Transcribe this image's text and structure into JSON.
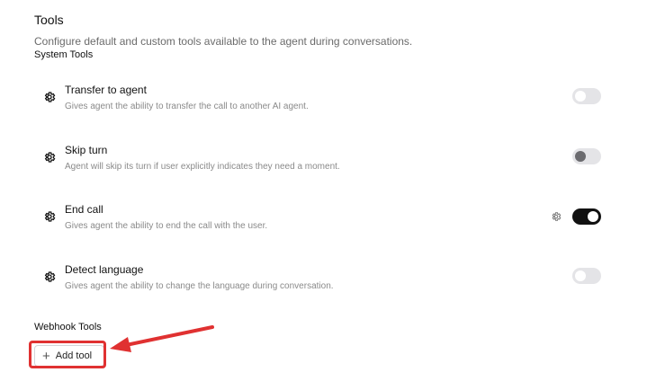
{
  "header": {
    "title": "Tools",
    "description": "Configure default and custom tools available to the agent during conversations."
  },
  "system_tools": {
    "title": "System Tools",
    "items": [
      {
        "name": "Transfer to agent",
        "description": "Gives agent the ability to transfer the call to another AI agent.",
        "enabled": false,
        "icon": "gear-icon"
      },
      {
        "name": "Skip turn",
        "description": "Agent will skip its turn if user explicitly indicates they need a moment.",
        "enabled": false,
        "icon": "gear-icon"
      },
      {
        "name": "End call",
        "description": "Gives agent the ability to end the call with the user.",
        "enabled": true,
        "icon": "gear-icon",
        "settings_icon": "gear-icon"
      },
      {
        "name": "Detect language",
        "description": "Gives agent the ability to change the language during conversation.",
        "enabled": false,
        "icon": "gear-icon"
      }
    ]
  },
  "webhook_tools": {
    "title": "Webhook Tools",
    "add_button_label": "Add tool",
    "add_button_icon": "plus-icon"
  },
  "colors": {
    "toggle_on": "#111111",
    "toggle_off": "#e4e4e7",
    "annotation": "#e03131"
  }
}
